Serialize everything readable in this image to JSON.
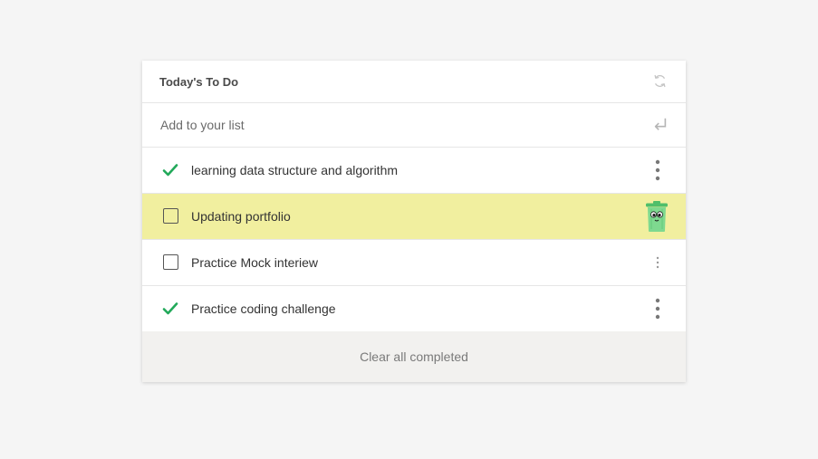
{
  "header": {
    "title": "Today's To Do",
    "refresh_icon": "refresh-icon"
  },
  "add_item": {
    "placeholder": "Add to your list",
    "value": "",
    "submit_icon": "enter-return-icon"
  },
  "todos": [
    {
      "label": "learning data structure and algorithm",
      "completed": true,
      "highlighted": false,
      "action_icon": "more-vertical-icon"
    },
    {
      "label": "Updating portfolio",
      "completed": false,
      "highlighted": true,
      "action_icon": "trash-can-icon"
    },
    {
      "label": "Practice Mock interiew",
      "completed": false,
      "highlighted": false,
      "action_icon": "more-vertical-icon"
    },
    {
      "label": "Practice coding challenge",
      "completed": true,
      "highlighted": false,
      "action_icon": "more-vertical-icon"
    }
  ],
  "footer": {
    "clear_label": "Clear all completed"
  },
  "colors": {
    "background": "#f5f5f5",
    "card": "#ffffff",
    "check_green": "#22a95a",
    "highlight_yellow": "#f1ef9f",
    "footer_bg": "#f2f1ef",
    "trash_green": "#7ed98f"
  }
}
